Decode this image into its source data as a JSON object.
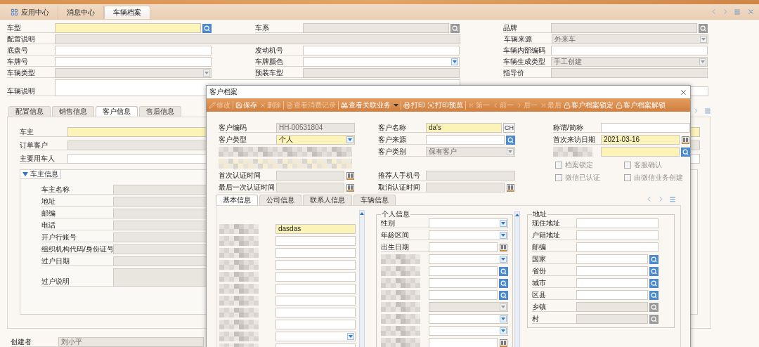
{
  "app_tabs": [
    {
      "label": "应用中心",
      "selected": false
    },
    {
      "label": "消息中心",
      "selected": false
    },
    {
      "label": "车辆档案",
      "selected": true
    }
  ],
  "vehicle_form": [
    [
      {
        "label": "车型",
        "kind": "lookup",
        "required": true,
        "readonly": false
      },
      {
        "label": "车系",
        "kind": "lookup",
        "required": false,
        "readonly": true
      },
      {
        "label": "品牌",
        "kind": "lookup",
        "required": false,
        "readonly": true
      }
    ],
    [
      {
        "label": "配置说明",
        "kind": "wide",
        "required": false,
        "readonly": true
      },
      {
        "label": "车辆来源",
        "kind": "dropdown",
        "value": "外来车",
        "required": false,
        "readonly": true
      }
    ],
    [
      {
        "label": "底盘号",
        "kind": "text",
        "required": false,
        "readonly": false
      },
      {
        "label": "发动机号",
        "kind": "text",
        "required": false,
        "readonly": false
      },
      {
        "label": "车辆内部编码",
        "kind": "text",
        "required": false,
        "readonly": false
      }
    ],
    [
      {
        "label": "车牌号",
        "kind": "text",
        "required": false,
        "readonly": false
      },
      {
        "label": "车牌颜色",
        "kind": "dropdown",
        "required": false,
        "readonly": false
      },
      {
        "label": "车辆生成类型",
        "kind": "dropdown",
        "value": "手工创建",
        "required": false,
        "readonly": true
      }
    ],
    [
      {
        "label": "车辆类型",
        "kind": "dropdown",
        "required": false,
        "readonly": true
      },
      {
        "label": "预装车型",
        "kind": "text",
        "required": false,
        "readonly": true
      },
      {
        "label": "指导价",
        "kind": "text",
        "required": false,
        "readonly": true
      }
    ],
    [
      {
        "label": "车辆说明",
        "kind": "textarea",
        "required": false,
        "readonly": false
      },
      {
        "kind": "text",
        "required": false,
        "readonly": false
      }
    ]
  ],
  "vehicle_tabs": [
    {
      "label": "配置信息",
      "selected": false
    },
    {
      "label": "销售信息",
      "selected": false
    },
    {
      "label": "客户信息",
      "selected": true
    },
    {
      "label": "售后信息",
      "selected": false
    }
  ],
  "owner_fields": [
    {
      "label": "车主",
      "kind": "text",
      "required": true,
      "readonly": false
    },
    {
      "label": "订单客户",
      "kind": "text",
      "required": false,
      "readonly": true
    },
    {
      "label": "主要用车人",
      "kind": "text",
      "required": false,
      "readonly": false
    }
  ],
  "owner_group": {
    "title": "车主信息",
    "expanded": true,
    "fields": [
      {
        "label": "车主名称",
        "kind": "text",
        "required": false,
        "readonly": true
      },
      {
        "label": "地址",
        "kind": "text",
        "required": false,
        "readonly": true
      },
      {
        "label": "邮编",
        "kind": "text",
        "required": false,
        "readonly": true
      },
      {
        "label": "电话",
        "kind": "text",
        "required": false,
        "readonly": true
      },
      {
        "label": "开户行账号",
        "kind": "text",
        "required": false,
        "readonly": true
      },
      {
        "label": "组织机构代码/身份证号",
        "kind": "text",
        "required": false,
        "readonly": true
      },
      {
        "label": "过户日期",
        "kind": "text",
        "required": false,
        "readonly": true
      },
      {
        "label": "过户说明",
        "kind": "textarea",
        "required": false,
        "readonly": true
      }
    ]
  },
  "creator": {
    "label": "创建者",
    "kind": "text",
    "value": "刘小平",
    "required": false,
    "readonly": true
  },
  "dialog": {
    "title": "客户档案",
    "toolbar": [
      [
        {
          "label": "修改",
          "disabled": true
        }
      ],
      [
        {
          "label": "保存",
          "disabled": false
        },
        {
          "label": "删除",
          "disabled": true
        }
      ],
      [
        {
          "label": "查看消费记录",
          "disabled": true
        }
      ],
      [
        {
          "label": "查看关联业务",
          "disabled": false,
          "has_menu": true
        }
      ],
      [
        {
          "label": "打印",
          "disabled": false
        },
        {
          "label": "打印预览",
          "disabled": false
        }
      ],
      [
        {
          "label": "第一",
          "disabled": true
        },
        {
          "label": "前一",
          "disabled": true
        },
        {
          "label": "后一",
          "disabled": true
        },
        {
          "label": "最后",
          "disabled": true
        },
        {
          "label": "客户档案锁定",
          "disabled": false
        },
        {
          "label": "客户档案解锁",
          "disabled": false
        }
      ]
    ],
    "columns": [
      [
        {
          "label": "客户编码",
          "kind": "text",
          "value": "HH-00531804",
          "required": false,
          "readonly": true
        },
        {
          "label": "客户类型",
          "kind": "dropdown",
          "value": "个人",
          "required": true,
          "readonly": false
        },
        {
          "kind": "redacted"
        },
        {
          "kind": "redacted"
        },
        {
          "label": "首次认证时间",
          "kind": "date",
          "required": false,
          "readonly": true
        },
        {
          "label": "最后一次认证时间",
          "kind": "date",
          "required": false,
          "readonly": true
        }
      ],
      [
        {
          "label": "客户名称",
          "kind": "text",
          "value": "da's",
          "button": "CH",
          "required": true,
          "readonly": false
        },
        {
          "label": "客户来源",
          "kind": "lookup",
          "required": false,
          "readonly": false
        },
        {
          "label": "客户类别",
          "kind": "dropdown",
          "value": "保有客户",
          "required": false,
          "readonly": true
        },
        {
          "kind": "blank"
        },
        {
          "label": "推荐人手机号",
          "kind": "text",
          "required": false,
          "readonly": true
        },
        {
          "label": "取消认证时间",
          "kind": "date",
          "required": false,
          "readonly": true
        }
      ],
      [
        {
          "label": "称谓/简称",
          "kind": "text",
          "required": false,
          "readonly": false
        },
        {
          "label": "首次来访日期",
          "kind": "date",
          "value": "2021-03-16",
          "required": true,
          "readonly": false
        },
        {
          "label_redacted": true,
          "kind": "lookup",
          "required": true,
          "readonly": false
        }
      ]
    ],
    "checkboxes": [
      {
        "label": "档案锁定",
        "checked": false,
        "disabled": true
      },
      {
        "label": "客服确认",
        "checked": false,
        "disabled": true
      },
      {
        "label": "微信已认证",
        "checked": false,
        "disabled": true
      },
      {
        "label": "由微信业务创建",
        "checked": false,
        "disabled": true
      }
    ],
    "tabs": [
      {
        "label": "基本信息",
        "selected": true
      },
      {
        "label": "公司信息",
        "selected": false
      },
      {
        "label": "联系人信息",
        "selected": false
      },
      {
        "label": "车辆信息",
        "selected": false
      }
    ],
    "basic_fields": [
      {
        "label_redacted": true,
        "kind": "text",
        "value": "dasdas",
        "required": true,
        "readonly": false
      },
      {
        "label_redacted": true,
        "kind": "text",
        "required": false,
        "readonly": false
      },
      {
        "label_redacted": true,
        "kind": "text",
        "required": false,
        "readonly": false
      },
      {
        "label_redacted": true,
        "kind": "text",
        "required": false,
        "readonly": false
      },
      {
        "label_redacted": true,
        "kind": "text",
        "required": false,
        "readonly": false
      },
      {
        "label_redacted": true,
        "kind": "text",
        "required": false,
        "readonly": false
      },
      {
        "label_redacted": true,
        "kind": "text",
        "required": false,
        "readonly": false
      },
      {
        "label_redacted": true,
        "kind": "text",
        "required": false,
        "readonly": false
      },
      {
        "label_redacted": true,
        "kind": "text",
        "required": false,
        "readonly": false
      },
      {
        "label_redacted": true,
        "kind": "dropdown",
        "required": false,
        "readonly": false
      },
      {
        "label_redacted": true,
        "kind": "text",
        "required": false,
        "readonly": false
      }
    ],
    "personal_group": {
      "title": "个人信息",
      "fields": [
        {
          "label": "性别",
          "kind": "dropdown",
          "required": false,
          "readonly": false
        },
        {
          "label": "年龄区间",
          "kind": "dropdown",
          "required": false,
          "readonly": false
        },
        {
          "label": "出生日期",
          "kind": "date",
          "required": false,
          "readonly": false
        },
        {
          "label_redacted": true,
          "kind": "dropdown",
          "required": false,
          "readonly": false
        },
        {
          "label_redacted": true,
          "kind": "lookup",
          "required": false,
          "readonly": false
        },
        {
          "label_redacted": true,
          "kind": "lookup",
          "required": false,
          "readonly": false
        },
        {
          "label_redacted": true,
          "kind": "lookup",
          "required": false,
          "readonly": false
        },
        {
          "label_redacted": true,
          "kind": "dropdown",
          "required": false,
          "readonly": true
        },
        {
          "label_redacted": true,
          "kind": "dropdown",
          "required": false,
          "readonly": false
        },
        {
          "label_redacted": true,
          "kind": "dropdown",
          "required": false,
          "readonly": false
        },
        {
          "label_redacted": true,
          "kind": "date",
          "required": false,
          "readonly": false
        }
      ]
    },
    "address_group": {
      "title": "地址",
      "fields": [
        {
          "label": "现住地址",
          "kind": "text",
          "required": false,
          "readonly": false
        },
        {
          "label": "户籍地址",
          "kind": "text",
          "required": false,
          "readonly": false
        },
        {
          "label": "邮编",
          "kind": "text",
          "required": false,
          "readonly": false
        },
        {
          "label": "国家",
          "kind": "lookup",
          "required": false,
          "readonly": false
        },
        {
          "label": "省份",
          "kind": "lookup",
          "required": false,
          "readonly": false
        },
        {
          "label": "城市",
          "kind": "lookup",
          "required": false,
          "readonly": false
        },
        {
          "label": "区县",
          "kind": "lookup",
          "required": false,
          "readonly": false
        },
        {
          "label": "乡镇",
          "kind": "lookup",
          "required": false,
          "readonly": true
        },
        {
          "label": "村",
          "kind": "lookup",
          "required": false,
          "readonly": true
        }
      ]
    }
  }
}
